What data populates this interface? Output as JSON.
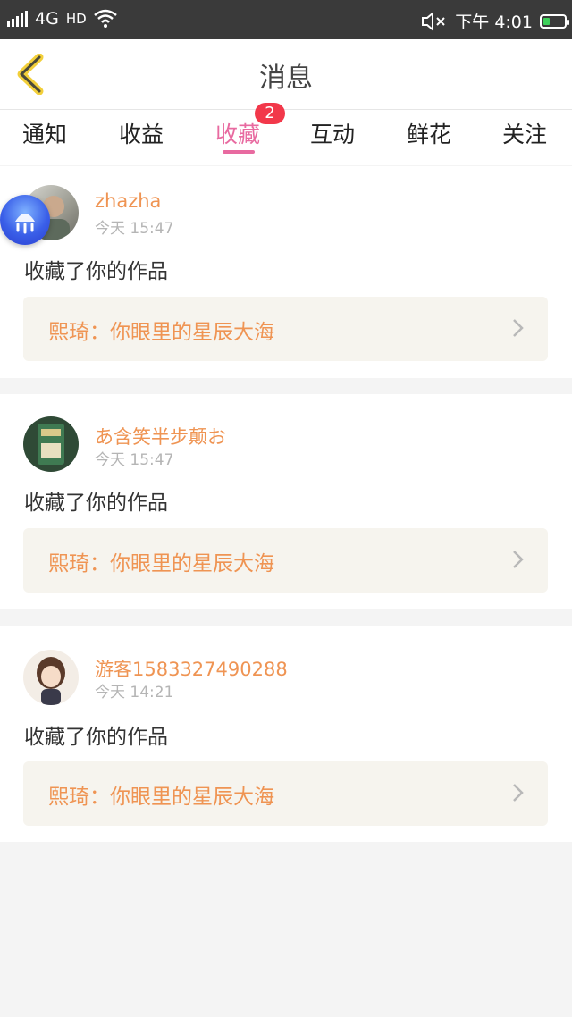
{
  "statusbar": {
    "network": "4G",
    "hd": "HD",
    "time_label": "下午 4:01"
  },
  "header": {
    "title": "消息"
  },
  "tabs": [
    {
      "label": "通知"
    },
    {
      "label": "收益"
    },
    {
      "label": "收藏",
      "active": true,
      "badge": "2"
    },
    {
      "label": "互动"
    },
    {
      "label": "鲜花"
    },
    {
      "label": "关注"
    }
  ],
  "items": [
    {
      "username": "zhazha",
      "time": "今天 15:47",
      "action": "收藏了你的作品",
      "work": "熙琦：你眼里的星辰大海"
    },
    {
      "username": "あ含笑半步颠お",
      "time": "今天 15:47",
      "action": "收藏了你的作品",
      "work": "熙琦：你眼里的星辰大海"
    },
    {
      "username": "游客1583327490288",
      "time": "今天 14:21",
      "action": "收藏了你的作品",
      "work": "熙琦：你眼里的星辰大海"
    }
  ],
  "colors": {
    "accent_pink": "#e86aa0",
    "username_orange": "#ef9453",
    "badge_red": "#f2384a",
    "back_arrow_yellow": "#f2cf3a"
  }
}
